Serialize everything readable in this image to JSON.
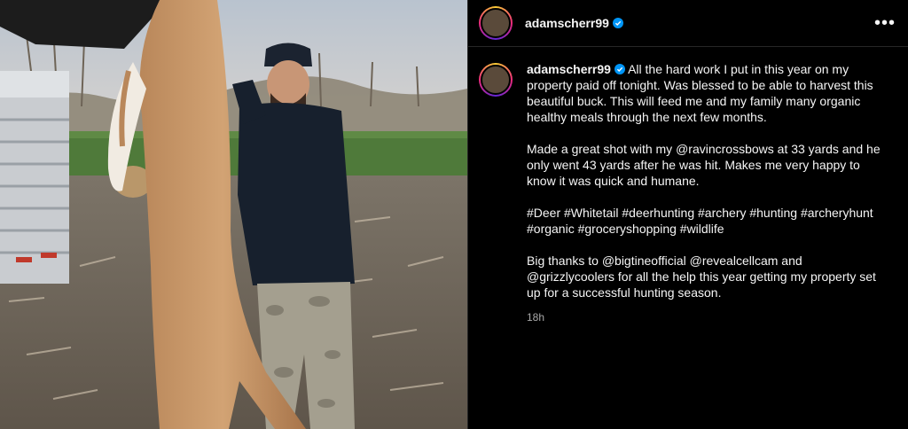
{
  "post": {
    "username": "adamscherr99",
    "verified": true,
    "more_icon": "more-horizontal-icon",
    "caption_line1": "All the hard work I put in this year on my property paid off tonight. Was blessed to be able to harvest this beautiful buck. This will feed me and my family many organic healthy meals through the next few months.",
    "caption_par2": "Made a great shot with my @ravincrossbows at 33 yards and he only went 43 yards after he was hit. Makes me very happy to know it was quick and humane.",
    "caption_par3": "#Deer #Whitetail #deerhunting #archery #hunting #archeryhunt #organic #groceryshopping #wildlife",
    "caption_par4": "Big thanks to @bigtineofficial @revealcellcam and @grizzlycoolers for all the help this year getting my property set up for a successful hunting season.",
    "time_ago": "18h"
  },
  "colors": {
    "background": "#000000",
    "text": "#f5f5f5",
    "muted": "#a8a8a8",
    "verified": "#0095f6",
    "divider": "#262626"
  }
}
